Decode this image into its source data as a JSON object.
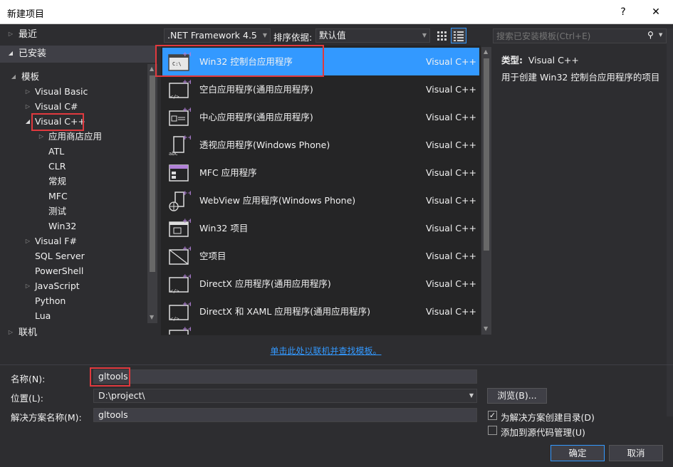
{
  "window": {
    "title": "新建项目",
    "help_label": "?",
    "close_label": "✕"
  },
  "sidebar": {
    "recent": "最近",
    "installed": "已安装",
    "templates": "模板",
    "items": [
      {
        "label": "Visual Basic"
      },
      {
        "label": "Visual C#"
      },
      {
        "label": "Visual C++"
      },
      {
        "label": "应用商店应用"
      },
      {
        "label": "ATL"
      },
      {
        "label": "CLR"
      },
      {
        "label": "常规"
      },
      {
        "label": "MFC"
      },
      {
        "label": "测试"
      },
      {
        "label": "Win32"
      },
      {
        "label": "Visual F#"
      },
      {
        "label": "SQL Server"
      },
      {
        "label": "PowerShell"
      },
      {
        "label": "JavaScript"
      },
      {
        "label": "Python"
      },
      {
        "label": "Lua"
      }
    ],
    "online": "联机"
  },
  "toolbar": {
    "framework": ".NET Framework 4.5",
    "sort_label": "排序依据:",
    "sort_value": "默认值",
    "search_placeholder": "搜索已安装模板(Ctrl+E)"
  },
  "templates": [
    {
      "name": "Win32 控制台应用程序",
      "lang": "Visual C++"
    },
    {
      "name": "空白应用程序(通用应用程序)",
      "lang": "Visual C++"
    },
    {
      "name": "中心应用程序(通用应用程序)",
      "lang": "Visual C++"
    },
    {
      "name": "透视应用程序(Windows Phone)",
      "lang": "Visual C++"
    },
    {
      "name": "MFC 应用程序",
      "lang": "Visual C++"
    },
    {
      "name": "WebView 应用程序(Windows Phone)",
      "lang": "Visual C++"
    },
    {
      "name": "Win32 项目",
      "lang": "Visual C++"
    },
    {
      "name": "空项目",
      "lang": "Visual C++"
    },
    {
      "name": "DirectX 应用程序(通用应用程序)",
      "lang": "Visual C++"
    },
    {
      "name": "DirectX 和 XAML 应用程序(通用应用程序)",
      "lang": "Visual C++"
    }
  ],
  "details": {
    "type_label": "类型:",
    "type_value": "Visual C++",
    "description": "用于创建 Win32 控制台应用程序的项目"
  },
  "online_link": "单击此处以联机并查找模板。",
  "form": {
    "name_label": "名称(N):",
    "name_value": "gltools",
    "location_label": "位置(L):",
    "location_value": "D:\\project\\",
    "solution_label": "解决方案名称(M):",
    "solution_value": "gltools",
    "browse": "浏览(B)...",
    "create_dir": "为解决方案创建目录(D)",
    "create_dir_checked": true,
    "add_source": "添加到源代码管理(U)",
    "add_source_checked": false,
    "ok": "确定",
    "cancel": "取消"
  }
}
